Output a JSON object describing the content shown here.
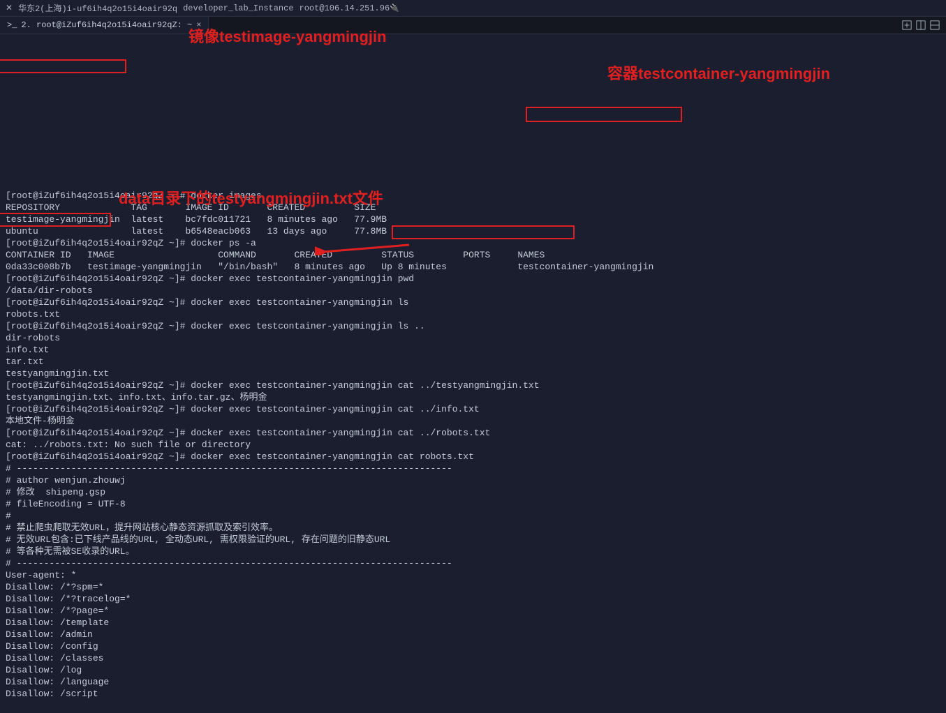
{
  "title_bar": {
    "region": "华东2(上海)i-uf6ih4q2o15i4oair92q",
    "instance": "developer_lab_Instance",
    "host": "root@106.14.251.96"
  },
  "tab": {
    "label": "2. root@iZuf6ih4q2o15i4oair92qZ: ~"
  },
  "annotations": {
    "a1": "镜像testimage-yangmingjin",
    "a2": "容器testcontainer-yangmingjin",
    "a3": "data目录下的testyangmingjin.txt文件"
  },
  "terminal_text": "[root@iZuf6ih4q2o15i4oair92qZ ~]# docker images\nREPOSITORY             TAG       IMAGE ID       CREATED         SIZE\ntestimage-yangmingjin  latest    bc7fdc011721   8 minutes ago   77.9MB\nubuntu                 latest    b6548eacb063   13 days ago     77.8MB\n[root@iZuf6ih4q2o15i4oair92qZ ~]# docker ps -a\nCONTAINER ID   IMAGE                   COMMAND       CREATED         STATUS         PORTS     NAMES\n0da33c008b7b   testimage-yangmingjin   \"/bin/bash\"   8 minutes ago   Up 8 minutes             testcontainer-yangmingjin\n[root@iZuf6ih4q2o15i4oair92qZ ~]# docker exec testcontainer-yangmingjin pwd\n/data/dir-robots\n[root@iZuf6ih4q2o15i4oair92qZ ~]# docker exec testcontainer-yangmingjin ls\nrobots.txt\n[root@iZuf6ih4q2o15i4oair92qZ ~]# docker exec testcontainer-yangmingjin ls ..\ndir-robots\ninfo.txt\ntar.txt\ntestyangmingjin.txt\n[root@iZuf6ih4q2o15i4oair92qZ ~]# docker exec testcontainer-yangmingjin cat ../testyangmingjin.txt\ntestyangmingjin.txt、info.txt、info.tar.gz、杨明金\n[root@iZuf6ih4q2o15i4oair92qZ ~]# docker exec testcontainer-yangmingjin cat ../info.txt\n本地文件-杨明金\n[root@iZuf6ih4q2o15i4oair92qZ ~]# docker exec testcontainer-yangmingjin cat ../robots.txt\ncat: ../robots.txt: No such file or directory\n[root@iZuf6ih4q2o15i4oair92qZ ~]# docker exec testcontainer-yangmingjin cat robots.txt\n# --------------------------------------------------------------------------------\n# author wenjun.zhouwj\n# 修改  shipeng.gsp\n# fileEncoding = UTF-8\n#\n# 禁止爬虫爬取无效URL，提升网站核心静态资源抓取及索引效率。\n# 无效URL包含:已下线产品线的URL, 全动态URL, 需权限验证的URL, 存在问题的旧静态URL\n# 等各种无需被SE收录的URL。\n# --------------------------------------------------------------------------------\nUser-agent: *\nDisallow: /*?spm=*\nDisallow: /*?tracelog=*\nDisallow: /*?page=*\nDisallow: /template\nDisallow: /admin\nDisallow: /config\nDisallow: /classes\nDisallow: /log\nDisallow: /language\nDisallow: /script"
}
